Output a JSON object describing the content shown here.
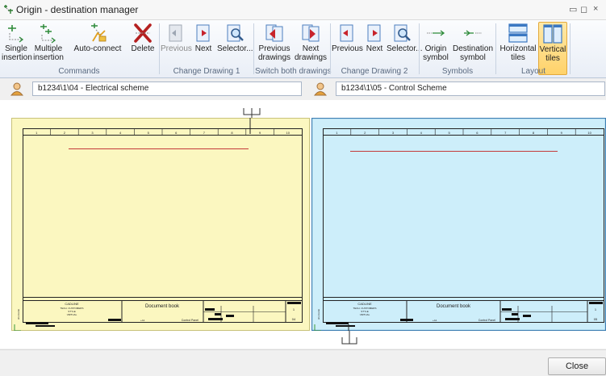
{
  "window": {
    "title": "Origin - destination manager",
    "controls": [
      "▭",
      "◻",
      "×"
    ]
  },
  "ribbon": {
    "groups": [
      {
        "id": "commands",
        "label": "Commands",
        "buttons": [
          {
            "label1": "Single",
            "label2": "insertion",
            "icon": "single-insertion-icon"
          },
          {
            "label1": "Multiple",
            "label2": "insertion",
            "icon": "multiple-insertion-icon"
          },
          {
            "label1": "Auto-connect",
            "label2": "",
            "icon": "auto-connect-icon"
          },
          {
            "label1": "Delete",
            "label2": "",
            "icon": "delete-icon"
          }
        ]
      },
      {
        "id": "change1",
        "label": "Change Drawing 1",
        "buttons": [
          {
            "label1": "Previous",
            "label2": "",
            "icon": "previous-icon",
            "disabled": true
          },
          {
            "label1": "Next",
            "label2": "",
            "icon": "next-icon"
          },
          {
            "label1": "Selector...",
            "label2": "",
            "icon": "selector-icon"
          }
        ]
      },
      {
        "id": "switch-both",
        "label": "Switch both drawings",
        "buttons": [
          {
            "label1": "Previous",
            "label2": "drawings",
            "icon": "previous-drawings-icon"
          },
          {
            "label1": "Next",
            "label2": "drawings",
            "icon": "next-drawings-icon"
          }
        ]
      },
      {
        "id": "change2",
        "label": "Change Drawing 2",
        "buttons": [
          {
            "label1": "Previous",
            "label2": "",
            "icon": "previous-icon"
          },
          {
            "label1": "Next",
            "label2": "",
            "icon": "next-icon"
          },
          {
            "label1": "Selector...",
            "label2": "",
            "icon": "selector-icon"
          }
        ]
      },
      {
        "id": "symbols",
        "label": "Symbols",
        "buttons": [
          {
            "label1": "Origin",
            "label2": "symbol",
            "icon": "origin-symbol-icon"
          },
          {
            "label1": "Destination",
            "label2": "symbol",
            "icon": "destination-symbol-icon"
          }
        ]
      },
      {
        "id": "layout",
        "label": "Layout",
        "buttons": [
          {
            "label1": "Horizontal",
            "label2": "tiles",
            "icon": "horizontal-tiles-icon"
          },
          {
            "label1": "Vertical",
            "label2": "tiles",
            "icon": "vertical-tiles-icon",
            "active": true
          }
        ]
      }
    ]
  },
  "panes": {
    "left": {
      "path": "b1234\\1\\04 - Electrical scheme",
      "fill": "#fbf7c0",
      "border": "#c8c27a"
    },
    "right": {
      "path": "b1234\\1\\05 - Control Scheme",
      "fill": "#cdeefa",
      "border": "#3e7fb3"
    }
  },
  "drawing": {
    "columns": [
      "1",
      "2",
      "3",
      "4",
      "5",
      "6",
      "7",
      "8",
      "9",
      "10"
    ],
    "titleblock": {
      "company": "CADLINE",
      "company_sub": [
        "TECH. CUSTOMERS",
        "STYLE",
        "VIRTUAL"
      ],
      "document": "Document book",
      "panel": "Control Panel",
      "rev": "1",
      "sheet_left": "04",
      "sheet_right": "05",
      "small": "+A1",
      "side": "shorcutdo"
    }
  },
  "footer": {
    "close_label": "Close"
  },
  "colors": {
    "accent": "#e3a93b",
    "wire": "#c33a3a"
  }
}
